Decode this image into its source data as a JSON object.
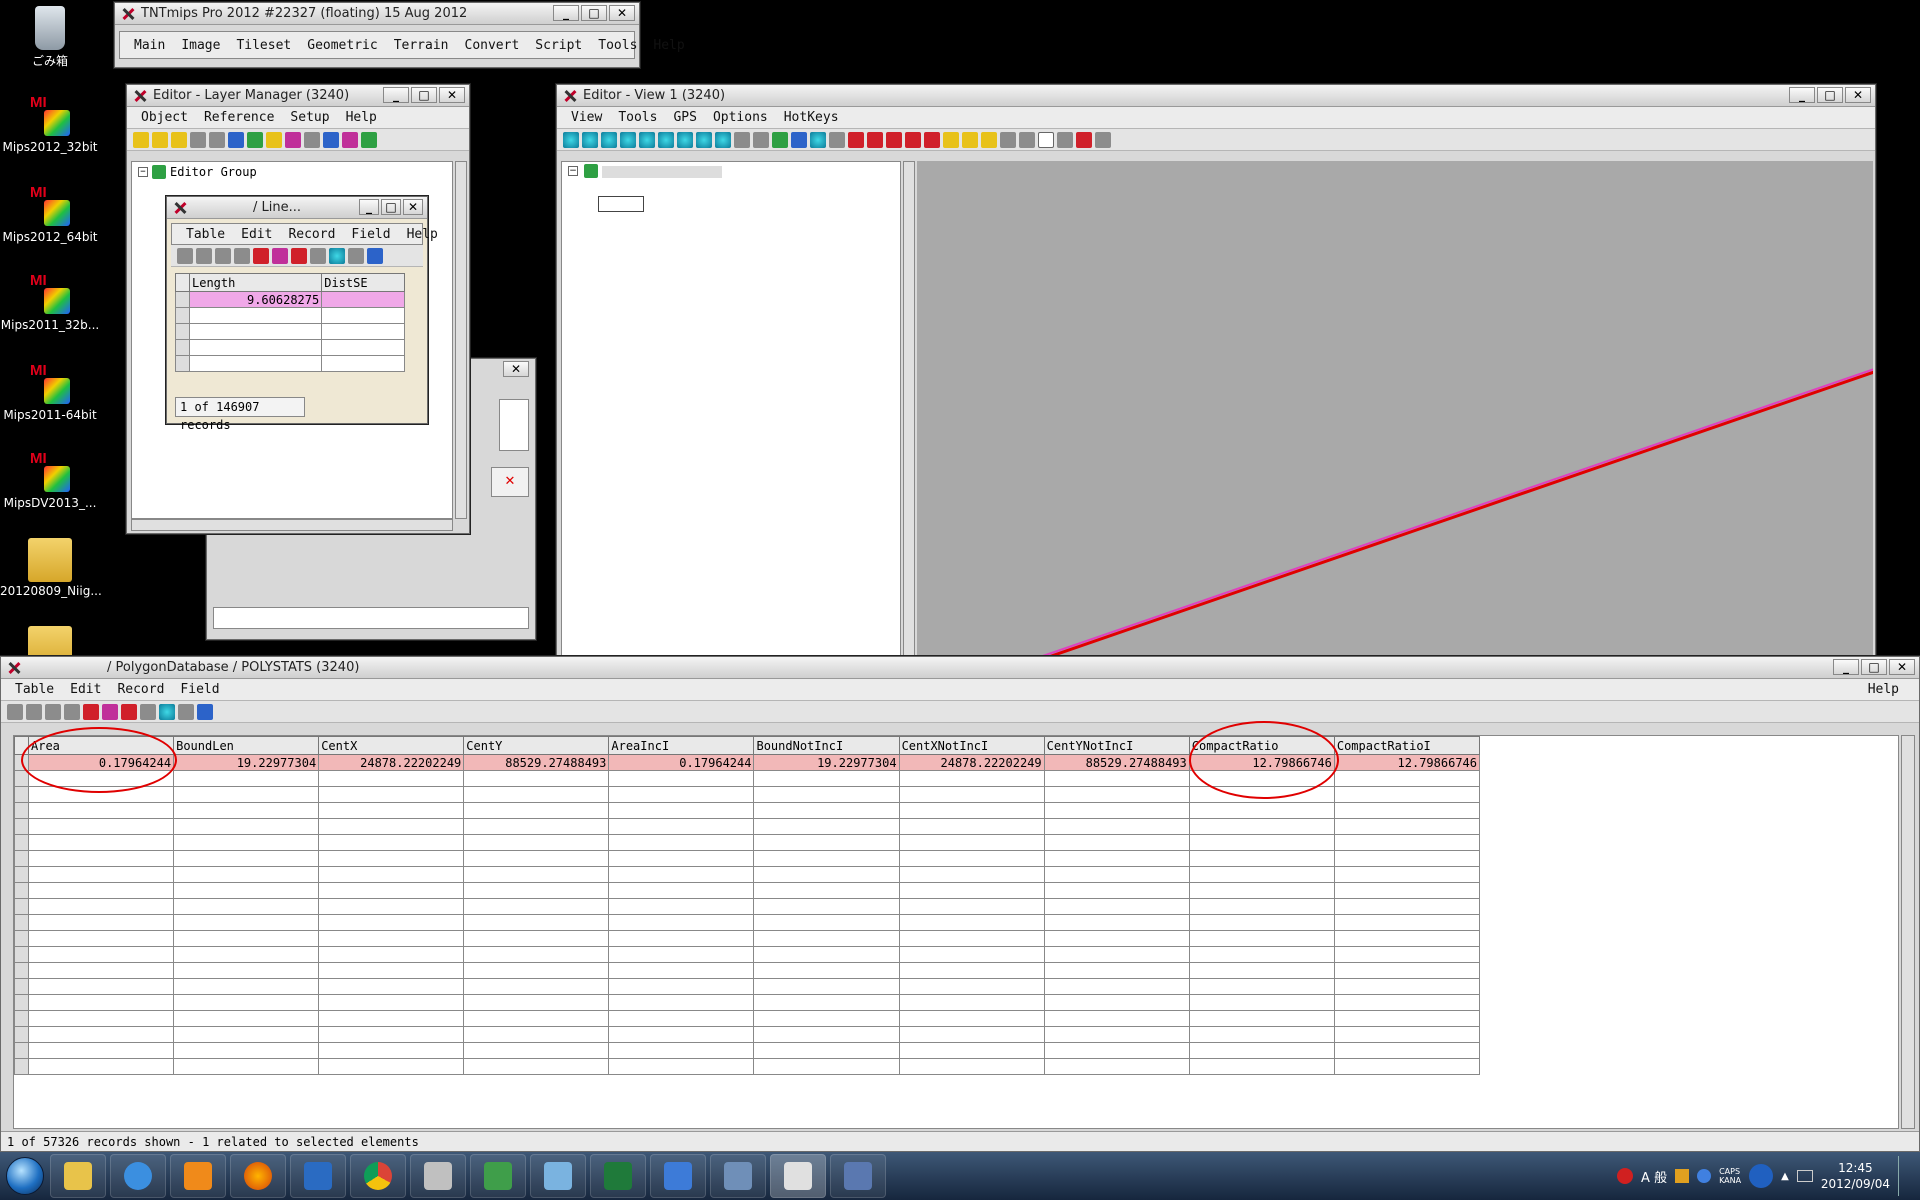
{
  "desktop": {
    "icons": [
      {
        "label": "ごみ箱"
      },
      {
        "label": "Mips2012_32bit"
      },
      {
        "label": "Mips2012_64bit"
      },
      {
        "label": "Mips2011_32b..."
      },
      {
        "label": "Mips2011-64bit"
      },
      {
        "label": "MipsDV2013_..."
      },
      {
        "label": "20120809_Niig..."
      }
    ]
  },
  "main_window": {
    "title": "TNTmips Pro 2012     #22327 (floating)    15 Aug 2012",
    "menu": [
      "Main",
      "Image",
      "Tileset",
      "Geometric",
      "Terrain",
      "Convert",
      "Script",
      "Tools",
      "Help"
    ]
  },
  "layer_manager": {
    "title": "Editor - Layer Manager (3240)",
    "menu": [
      "Object",
      "Reference",
      "Setup",
      "Help"
    ],
    "tree_group": "Editor Group"
  },
  "line_table": {
    "title": "/ Line...",
    "menu": [
      "Table",
      "Edit",
      "Record",
      "Field",
      "Help"
    ],
    "columns": [
      "Length",
      "DistSE"
    ],
    "rows": [
      [
        "9.60628275",
        ""
      ],
      [
        "",
        ""
      ],
      [
        "",
        ""
      ],
      [
        "",
        ""
      ],
      [
        "",
        ""
      ]
    ],
    "status": "1 of 146907 records"
  },
  "view_window": {
    "title": "Editor - View 1 (3240)",
    "menu": [
      "View",
      "Tools",
      "GPS",
      "Options",
      "HotKeys"
    ]
  },
  "polystats": {
    "title": "/ PolygonDatabase / POLYSTATS (3240)",
    "menu": [
      "Table",
      "Edit",
      "Record",
      "Field"
    ],
    "help": "Help",
    "columns": [
      "Area",
      "BoundLen",
      "CentX",
      "CentY",
      "AreaIncI",
      "BoundNotIncI",
      "CentXNotIncI",
      "CentYNotIncI",
      "CompactRatio",
      "CompactRatioI"
    ],
    "selected_row": [
      "0.17964244",
      "19.22977304",
      "24878.22202249",
      "88529.27488493",
      "0.17964244",
      "19.22977304",
      "24878.22202249",
      "88529.27488493",
      "12.79866746",
      "12.79866746"
    ],
    "status": "1 of 57326 records shown - 1 related to selected elements"
  },
  "taskbar": {
    "ime": "A 般",
    "caps": "CAPS",
    "kana": "KANA",
    "time": "12:45",
    "date": "2012/09/04"
  },
  "colors": {
    "selected_row": "#f2b8b8",
    "line_table_row": "#f0a8e8",
    "annotation": "#e00000",
    "map_bg": "#a9a9a9",
    "line_pink": "#e040c0",
    "line_red": "#e00000"
  }
}
